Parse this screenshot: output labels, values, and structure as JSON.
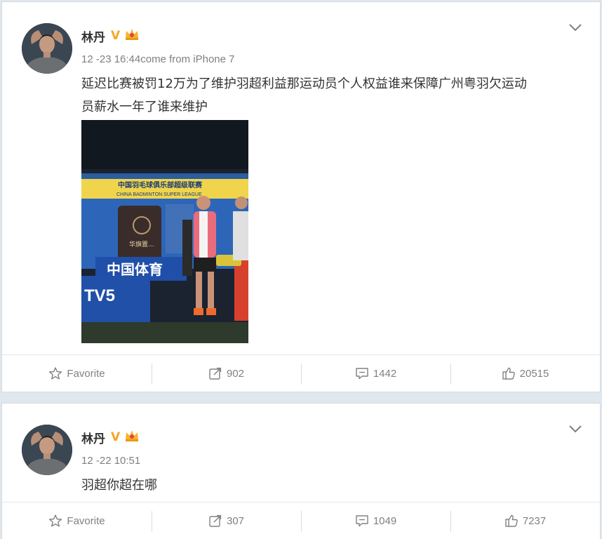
{
  "posts": [
    {
      "username": "林丹",
      "verified_badge": "V",
      "timestamp": "12 -23 16:44",
      "source": "come from iPhone 7",
      "text_line1": "延迟比赛被罚12万为了维护羽超利益那运动员个人权益谁来保障广州粤羽欠运动",
      "text_line2": "员薪水一年了谁来维护",
      "photo": {
        "banner_cn": "中国羽毛球俱乐部超级联赛",
        "banner_en": "CHINA BADMINTON SUPER LEAGUE",
        "board_text": "华旗置...",
        "tv_logo": "TV5",
        "sign_text": "中国体育"
      },
      "actions": {
        "favorite": "Favorite",
        "reposts": "902",
        "comments": "1442",
        "likes": "20515"
      }
    },
    {
      "username": "林丹",
      "verified_badge": "V",
      "timestamp": "12 -22 10:51",
      "text_line1": "羽超你超在哪",
      "actions": {
        "favorite": "Favorite",
        "reposts": "307",
        "comments": "1049",
        "likes": "7237"
      }
    }
  ],
  "icons": {
    "menu": "chevron-down-icon",
    "favorite": "star-icon",
    "repost": "repost-icon",
    "comment": "comment-icon",
    "like": "thumbs-up-icon",
    "badge": "crown-icon"
  },
  "colors": {
    "verified": "#f5a623",
    "username": "#333333",
    "meta": "#808080",
    "background": "#dfe7ef"
  }
}
